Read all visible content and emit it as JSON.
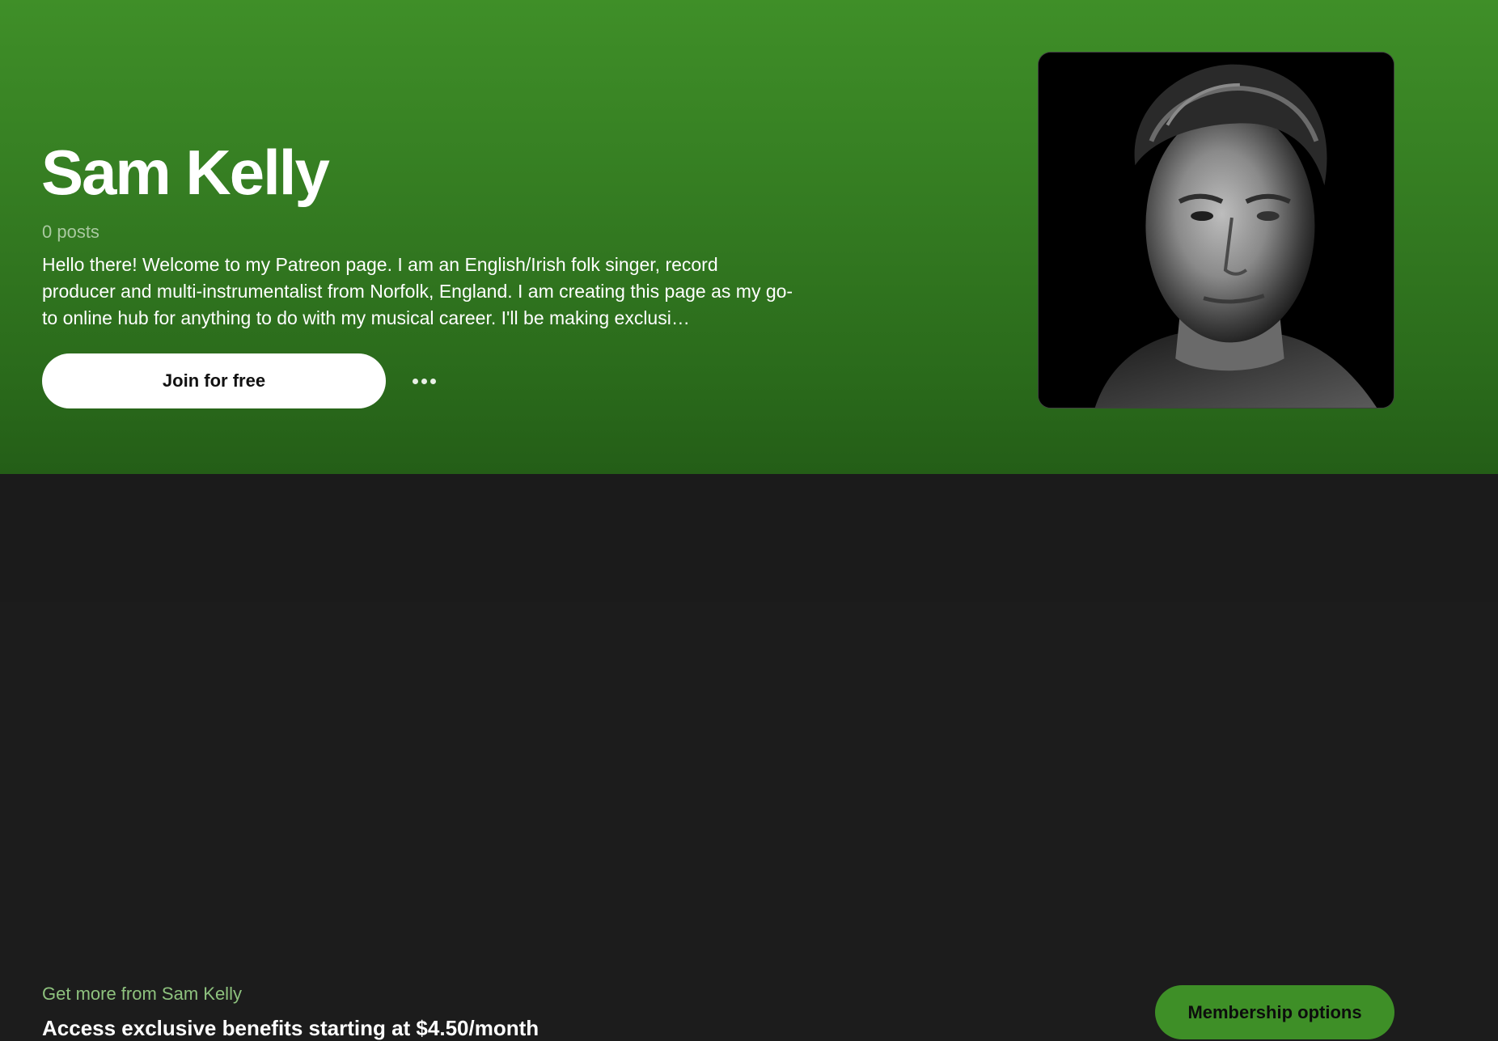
{
  "creator": {
    "name": "Sam Kelly",
    "post_count": "0 posts",
    "bio": "Hello there! Welcome to my Patreon page. I am an English/Irish folk singer, record producer and multi-instrumentalist from Norfolk, England. I am creating this page as my go-to online hub for anything to do with my musical career. I'll be making exclusi…",
    "avatar_icon": "creator-portrait"
  },
  "actions": {
    "join_label": "Join for free",
    "more_icon": "more-horizontal-icon"
  },
  "membership": {
    "teaser": "Get more from Sam Kelly",
    "benefits": "Access exclusive benefits starting at $4.50/month",
    "options_label": "Membership options"
  },
  "colors": {
    "brand_green": "#3e8f27",
    "hero_top": "#3f8f28",
    "hero_bottom": "#245e17",
    "dark_bar": "#1b1b1b"
  }
}
